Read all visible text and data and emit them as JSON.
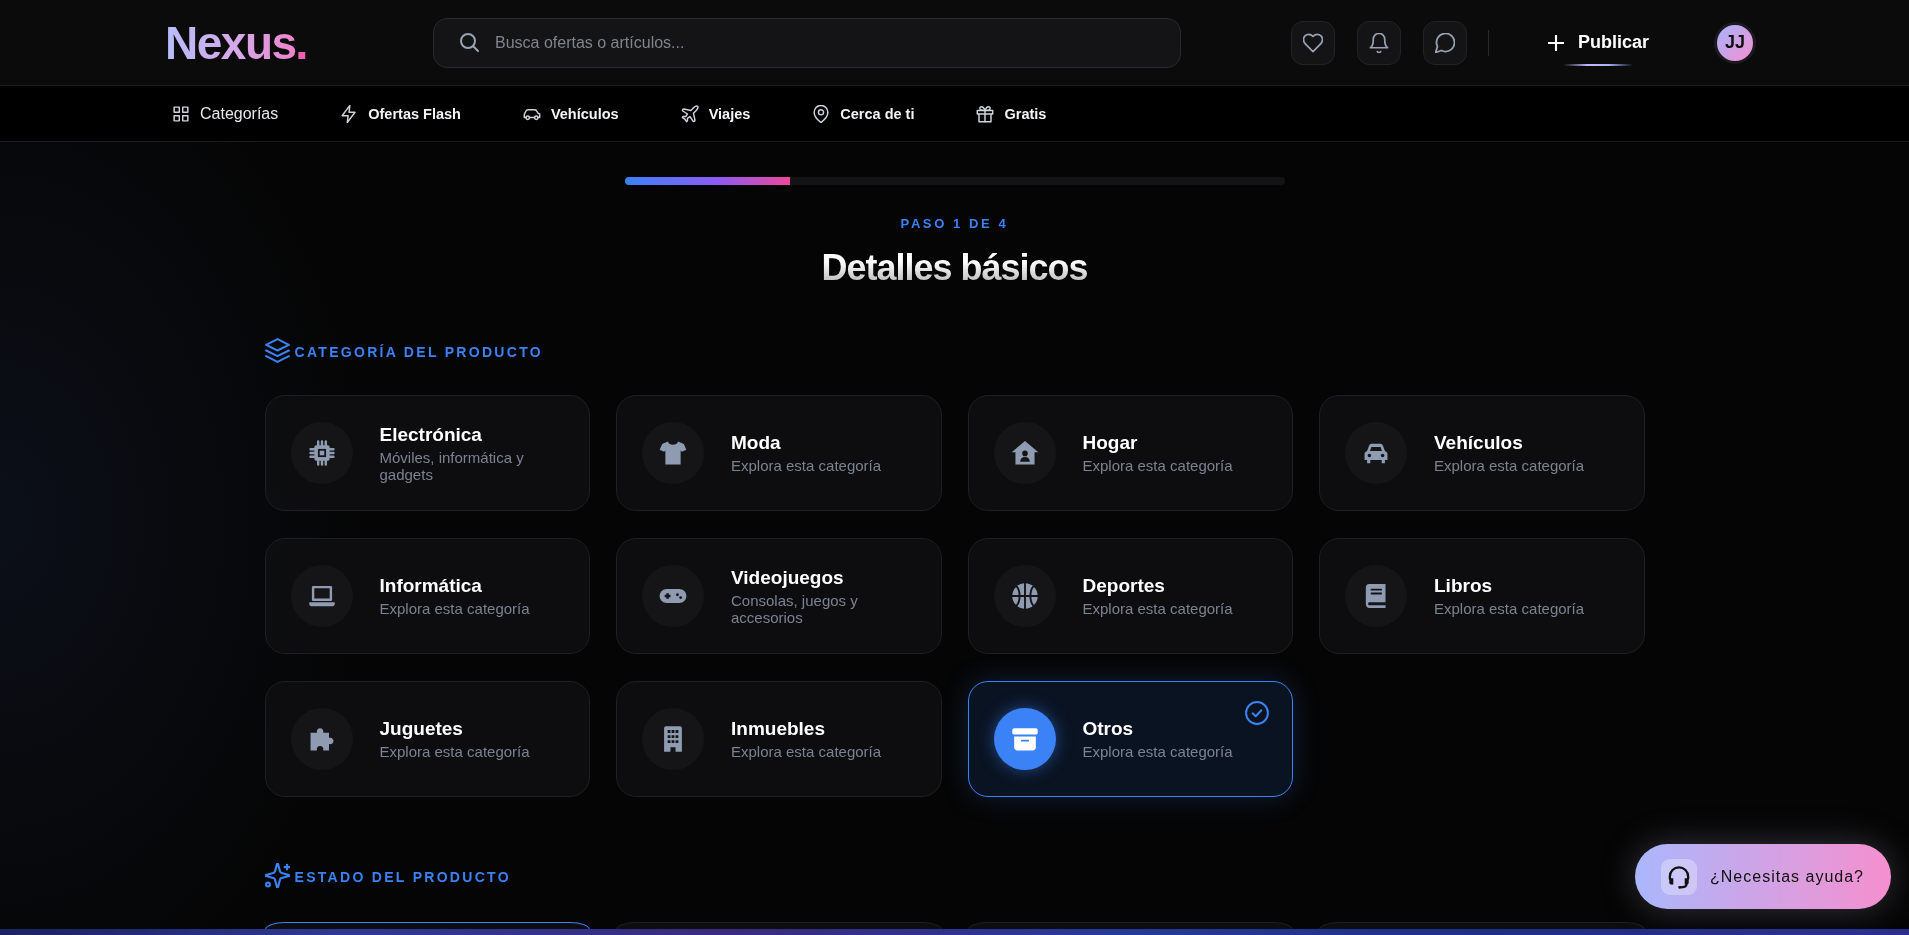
{
  "header": {
    "logo": {
      "name": "Nexus",
      "suffix": "."
    },
    "search": {
      "placeholder": "Busca ofertas o artículos..."
    },
    "publish_button": {
      "label": "Publicar"
    },
    "avatar": {
      "initials": "JJ"
    }
  },
  "nav": {
    "items": [
      {
        "label": "Categorías",
        "kind": "menu"
      },
      {
        "label": "Ofertas Flash",
        "kind": "link"
      },
      {
        "label": "Vehículos",
        "kind": "link"
      },
      {
        "label": "Viajes",
        "kind": "link"
      },
      {
        "label": "Cerca de ti",
        "kind": "link"
      },
      {
        "label": "Gratis",
        "kind": "link"
      }
    ]
  },
  "progress": {
    "level": 0.25
  },
  "step_label": "PASO 1 DE 4",
  "title": "Detalles básicos",
  "category_section": {
    "heading": "CATEGORÍA DEL PRODUCTO",
    "categories": [
      {
        "name": "Electrónica",
        "description": "Móviles, informática y gadgets",
        "selected": false
      },
      {
        "name": "Moda",
        "description": "Explora esta categoría",
        "selected": false
      },
      {
        "name": "Hogar",
        "description": "Explora esta categoría",
        "selected": false
      },
      {
        "name": "Vehículos",
        "description": "Explora esta categoría",
        "selected": false
      },
      {
        "name": "Informática",
        "description": "Explora esta categoría",
        "selected": false
      },
      {
        "name": "Videojuegos",
        "description": "Consolas, juegos y accesorios",
        "selected": false
      },
      {
        "name": "Deportes",
        "description": "Explora esta categoría",
        "selected": false
      },
      {
        "name": "Libros",
        "description": "Explora esta categoría",
        "selected": false
      },
      {
        "name": "Juguetes",
        "description": "Explora esta categoría",
        "selected": false
      },
      {
        "name": "Inmuebles",
        "description": "Explora esta categoría",
        "selected": false
      },
      {
        "name": "Otros",
        "description": "Explora esta categoría",
        "selected": true
      }
    ]
  },
  "condition_section": {
    "heading": "ESTADO DEL PRODUCTO",
    "options": [
      {
        "selected": true
      },
      {
        "selected": false
      },
      {
        "selected": false
      },
      {
        "selected": false
      }
    ]
  },
  "help_button": {
    "label": "¿Necesitas ayuda?"
  }
}
